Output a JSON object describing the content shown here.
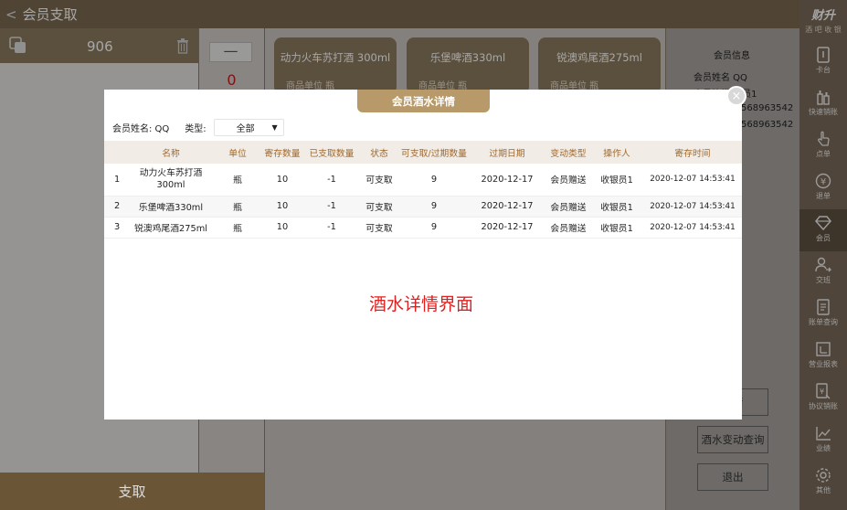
{
  "topbar": {
    "back": "<",
    "title": "会员支取"
  },
  "left": {
    "count": "906",
    "bottom_button": "支取"
  },
  "stepper": {
    "minus": "—",
    "qty": "0"
  },
  "products": [
    {
      "name": "动力火车苏打酒 300ml",
      "unit": "商品单位  瓶"
    },
    {
      "name": "乐堡啤酒330ml",
      "unit": "商品单位  瓶"
    },
    {
      "name": "锐澳鸡尾酒275ml",
      "unit": "商品单位  瓶"
    }
  ],
  "member_info": {
    "title": "会员信息",
    "name": "会员姓名  QQ",
    "line2": "会员等级  会员1",
    "phone1": "568963542",
    "phone2": "568963542"
  },
  "right_buttons": {
    "detail": "详情",
    "change_query": "酒水变动查询",
    "exit": "退出"
  },
  "nav": {
    "brand": "财升",
    "brand_sub": "酒 吧 收 银",
    "items": [
      "卡台",
      "快速销账",
      "点单",
      "退单",
      "会员",
      "交班",
      "账单查询",
      "营业报表",
      "协议销账",
      "业绩",
      "其他"
    ]
  },
  "modal": {
    "title": "会员酒水详情",
    "close": "×",
    "member_label": "会员姓名:  QQ",
    "type_label": "类型:",
    "type_value": "全部",
    "type_arrow": "▼",
    "columns": [
      "名称",
      "单位",
      "寄存数量",
      "已支取数量",
      "状态",
      "可支取/过期数量",
      "过期日期",
      "变动类型",
      "操作人",
      "寄存时间"
    ],
    "rows": [
      {
        "idx": "1",
        "name": "动力火车苏打酒 300ml",
        "unit": "瓶",
        "stored": "10",
        "taken": "-1",
        "status": "可支取",
        "avail": "9",
        "expire": "2020-12-17",
        "change": "会员赠送",
        "operator": "收银员1",
        "time": "2020-12-07 14:53:41"
      },
      {
        "idx": "2",
        "name": "乐堡啤酒330ml",
        "unit": "瓶",
        "stored": "10",
        "taken": "-1",
        "status": "可支取",
        "avail": "9",
        "expire": "2020-12-17",
        "change": "会员赠送",
        "operator": "收银员1",
        "time": "2020-12-07 14:53:41"
      },
      {
        "idx": "3",
        "name": "锐澳鸡尾酒275ml",
        "unit": "瓶",
        "stored": "10",
        "taken": "-1",
        "status": "可支取",
        "avail": "9",
        "expire": "2020-12-17",
        "change": "会员赠送",
        "operator": "收银员1",
        "time": "2020-12-07 14:53:41"
      }
    ],
    "watermark": "酒水详情界面"
  },
  "colors": {
    "brand": "#8d7b5f",
    "accent_gold": "#b89a6a",
    "danger": "#c41e1e",
    "header_text": "#a06a2e"
  }
}
